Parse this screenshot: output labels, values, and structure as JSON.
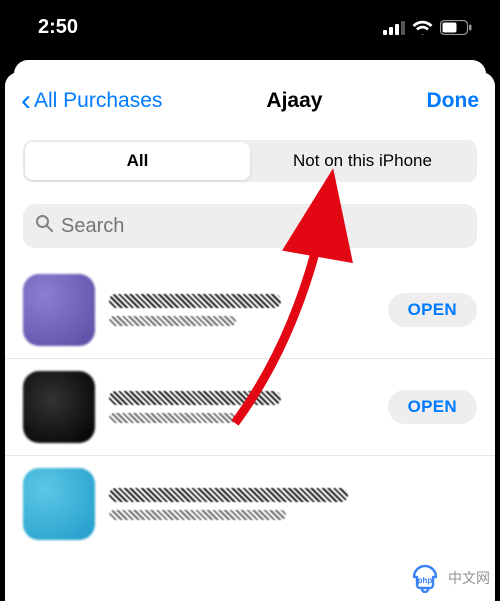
{
  "status": {
    "time": "2:50"
  },
  "nav": {
    "back_label": "All Purchases",
    "title": "Ajaay",
    "done": "Done"
  },
  "segmented": {
    "all": "All",
    "not_on": "Not on this iPhone"
  },
  "search": {
    "placeholder": "Search"
  },
  "buttons": {
    "open": "OPEN"
  },
  "watermark": {
    "text": "中文网"
  }
}
